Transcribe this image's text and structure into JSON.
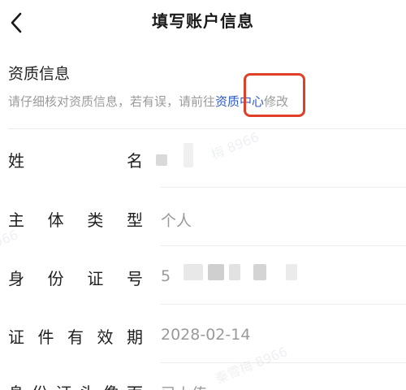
{
  "header": {
    "title": "填写账户信息"
  },
  "section": {
    "title": "资质信息",
    "desc_prefix": "请仔细核对资质信息，若有误，请前往",
    "link": "资质中心",
    "desc_suffix": "修改"
  },
  "rows": [
    {
      "label_chars": [
        "姓",
        "名"
      ],
      "value": ""
    },
    {
      "label_chars": [
        "主",
        "体",
        "类",
        "型"
      ],
      "value": "个人"
    },
    {
      "label_chars": [
        "身",
        "份",
        "证",
        "号"
      ],
      "value": "5"
    },
    {
      "label_chars": [
        "证",
        "件",
        "有",
        "效",
        "期"
      ],
      "value": "2028-02-14"
    },
    {
      "label_chars": [
        "身",
        "份",
        "证",
        "头",
        "像",
        "面"
      ],
      "value": "已上传"
    }
  ],
  "watermarks": [
    "梅 8966",
    "秦雪梅 8966",
    "966"
  ],
  "colors": {
    "link": "#2f59c7",
    "highlight": "#e0402a",
    "muted": "#9a9a9a"
  }
}
